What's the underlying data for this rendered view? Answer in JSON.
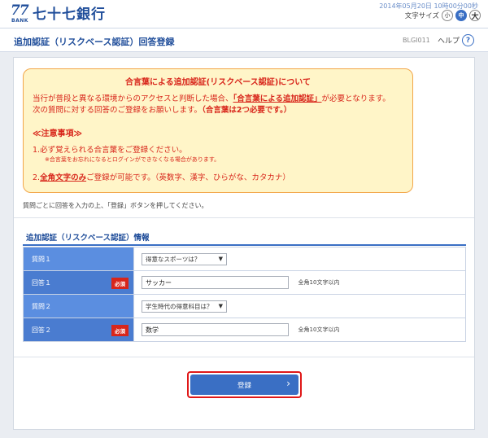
{
  "header": {
    "logo_number": "77",
    "logo_sub": "BANK",
    "bank_name": "七十七銀行",
    "datetime": "2014年05月20日 10時00分00秒",
    "fontsize_label": "文字サイズ",
    "fontsize_options": [
      "小",
      "中",
      "大"
    ],
    "fontsize_selected": "中"
  },
  "titlebar": {
    "title": "追加認証（リスクベース認証）回答登録",
    "screen_id": "BLGI011",
    "help_label": "ヘルプ",
    "help_icon": "?"
  },
  "notice": {
    "title": "合言葉による追加認証(リスクベース認証)について",
    "p1_a": "当行が普段と異なる環境からのアクセスと判断した場合、",
    "p1_link": "「合言葉による追加認証」",
    "p1_b": "が必要となります。",
    "p2_a": "次の質問に対する回答のご登録をお願いします。",
    "p2_b": "（合言葉は2つ必要です。）",
    "caution_heading": "≪注意事項≫",
    "c1": "1.必ず覚えられる合言葉をご登録ください。",
    "c1_note": "※合言葉をお忘れになるとログインができなくなる場合があります。",
    "c2_prefix": "2.",
    "c2_u": "全角文字のみ",
    "c2_rest": "ご登録が可能です。（英数字、漢字、ひらがな、カタカナ）"
  },
  "instruction": "質問ごとに回答を入力の上、「登録」ボタンを押してください。",
  "section_title": "追加認証（リスクベース認証）情報",
  "form": {
    "q1_label": "質問１",
    "q1_value": "得意なスポーツは？",
    "a1_label": "回答１",
    "a1_required": "必須",
    "a1_value": "サッカー",
    "a1_hint": "全角10文字以内",
    "q2_label": "質問２",
    "q2_value": "学生時代の得意科目は？",
    "a2_label": "回答２",
    "a2_required": "必須",
    "a2_value": "数学",
    "a2_hint": "全角10文字以内"
  },
  "submit_label": "登録",
  "colors": {
    "brand": "#1f4d9a",
    "accent": "#3a6fc4",
    "alert": "#d8261b"
  }
}
